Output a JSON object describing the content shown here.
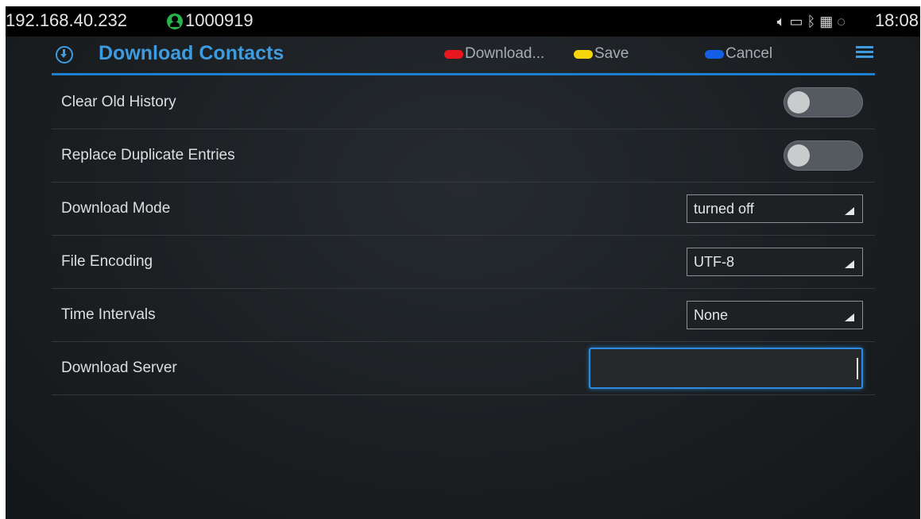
{
  "statusbar": {
    "ip": "192.168.40.232",
    "account": "1000919",
    "time": "18:08",
    "icons": [
      "volume-icon",
      "voicemail-icon",
      "bluetooth-icon",
      "sim-icon",
      "sync-icon"
    ]
  },
  "header": {
    "title": "Download Contacts",
    "softkeys": {
      "download": "Download...",
      "save": "Save",
      "cancel": "Cancel"
    },
    "colors": {
      "accent": "#3d9be0",
      "download": "#e8161e",
      "save": "#f5d50c",
      "cancel": "#1460e4"
    }
  },
  "settings": {
    "clear_old_history": {
      "label": "Clear Old History",
      "enabled": false
    },
    "replace_duplicates": {
      "label": "Replace Duplicate Entries",
      "enabled": false
    },
    "download_mode": {
      "label": "Download Mode",
      "value": "turned off"
    },
    "file_encoding": {
      "label": "File Encoding",
      "value": "UTF-8"
    },
    "time_intervals": {
      "label": "Time Intervals",
      "value": "None"
    },
    "download_server": {
      "label": "Download Server",
      "value": ""
    }
  }
}
